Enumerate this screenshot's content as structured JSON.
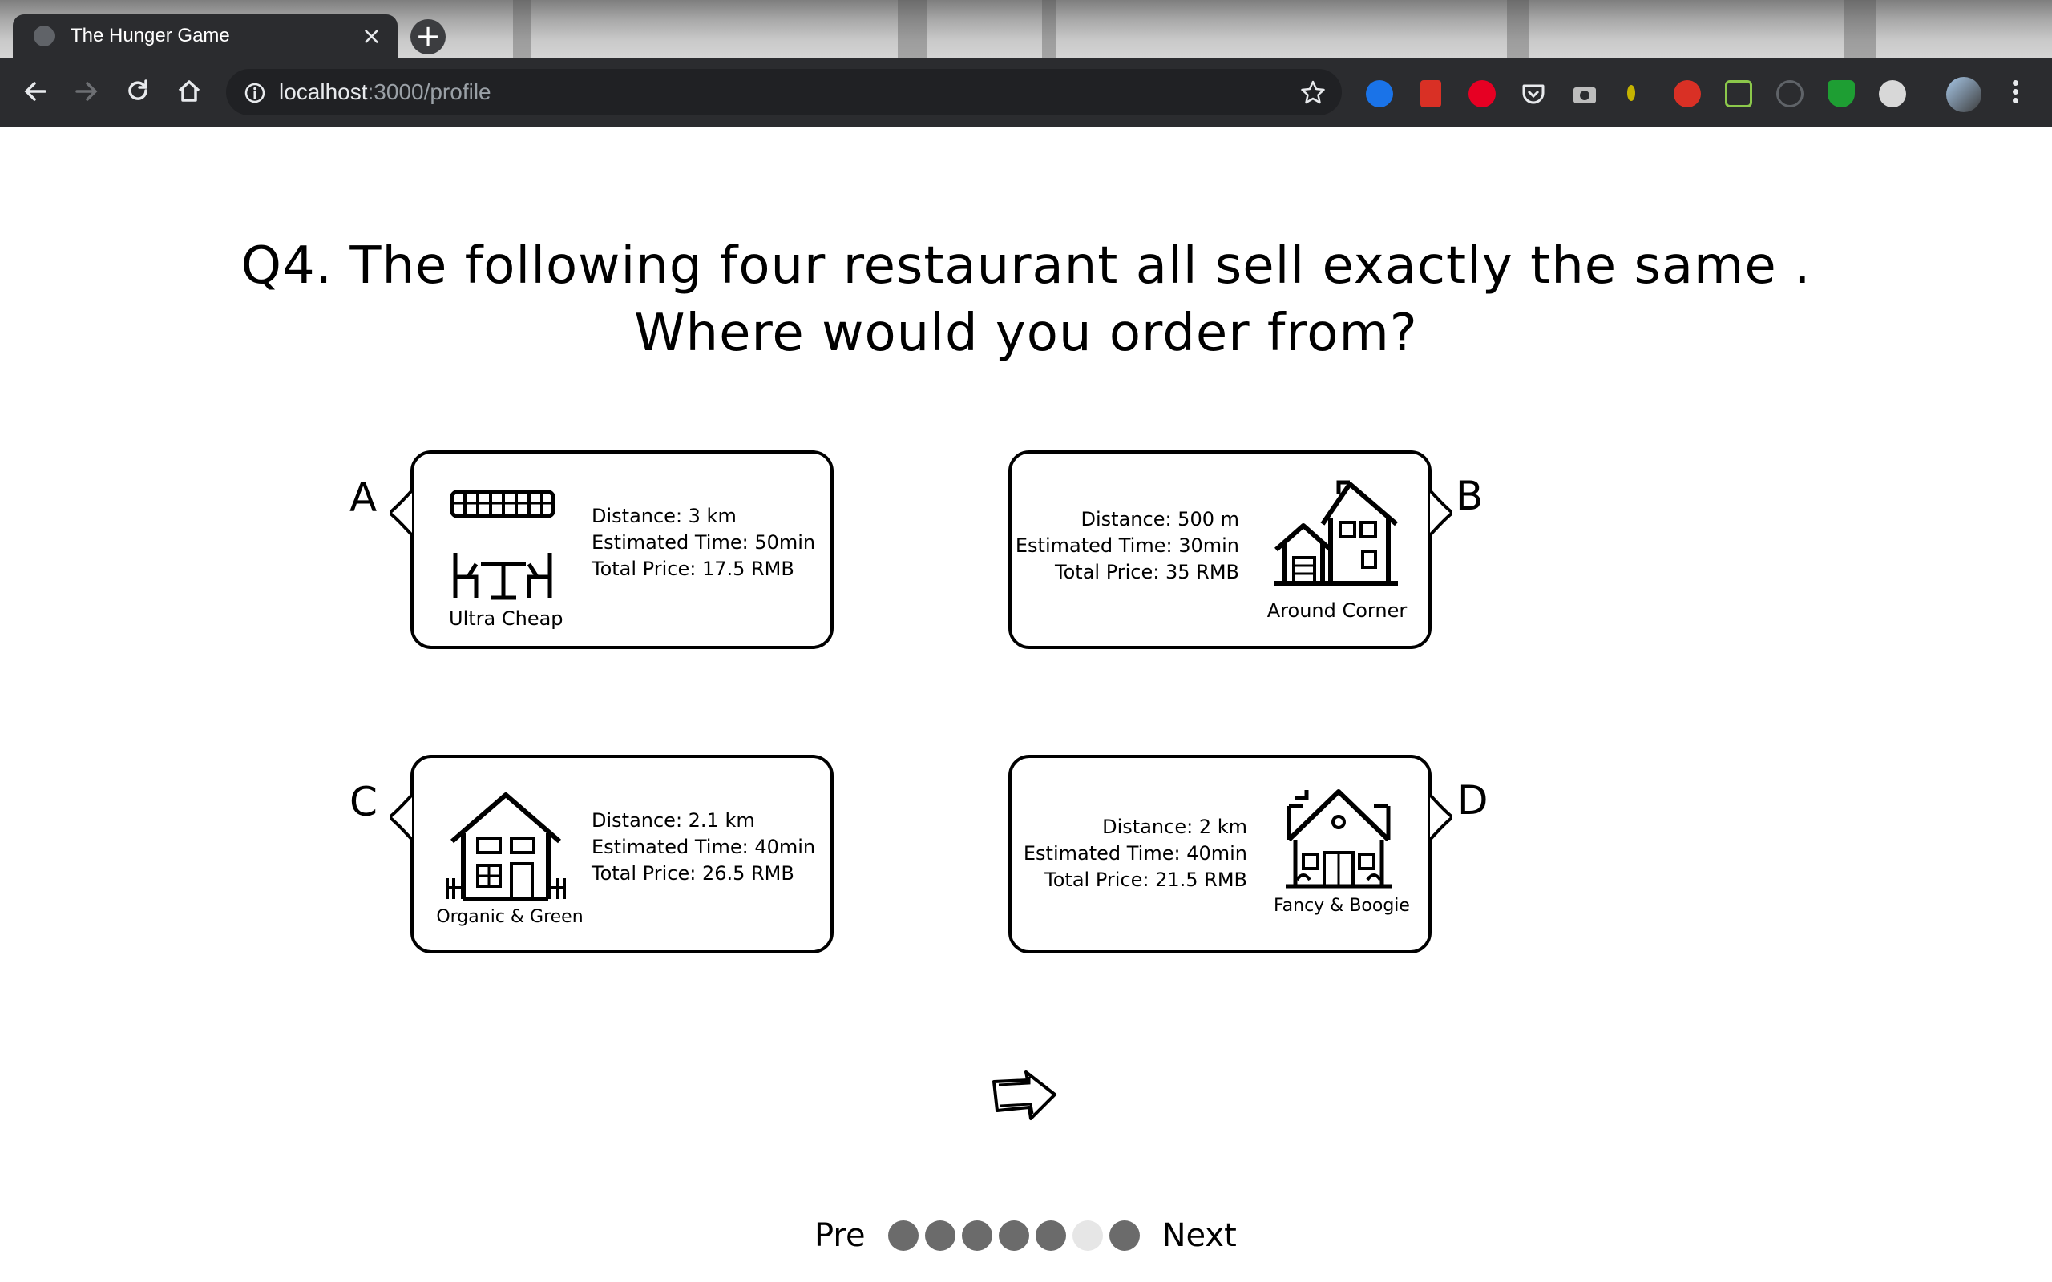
{
  "browser": {
    "tab_title": "The Hunger Game",
    "new_tab_symbol": "+",
    "close_symbol": "×",
    "url_host": "localhost",
    "url_path": ":3000/profile",
    "extensions": [
      "extension-blue-bank-icon",
      "extension-red-book-icon",
      "pinterest-icon",
      "pocket-icon",
      "camera-icon",
      "extension-lightbulb-icon",
      "adblock-hand-icon",
      "nodejs-icon",
      "extension-gauge-icon",
      "extension-green-shield-icon",
      "extension-circle-icon",
      "profile-avatar"
    ]
  },
  "page": {
    "question_line1": "Q4. The following four restaurant all sell exactly the same .",
    "question_line2": "Where would you order from?",
    "choices": [
      {
        "letter": "A",
        "name": "Ultra Cheap",
        "distance": "Distance: 3 km",
        "time": "Estimated Time: 50min",
        "price": "Total Price: 17.5 RMB",
        "icon": "market-stall-icon"
      },
      {
        "letter": "B",
        "name": "Around Corner",
        "distance": "Distance: 500 m",
        "time": "Estimated Time: 30min",
        "price": "Total Price: 35 RMB",
        "icon": "houses-icon"
      },
      {
        "letter": "C",
        "name": "Organic & Green",
        "distance": "Distance: 2.1 km",
        "time": "Estimated Time: 40min",
        "price": "Total Price: 26.5 RMB",
        "icon": "cottage-icon"
      },
      {
        "letter": "D",
        "name": "Fancy & Boogie",
        "distance": "Distance: 2 km",
        "time": "Estimated Time: 40min",
        "price": "Total Price: 21.5 RMB",
        "icon": "mansion-icon"
      }
    ],
    "next_arrow_icon": "hand-drawn-arrow-icon",
    "pager": {
      "prev": "Pre",
      "next": "Next",
      "total": 7,
      "current": 6
    }
  }
}
